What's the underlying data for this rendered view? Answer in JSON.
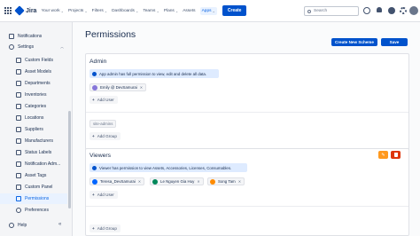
{
  "topnav": {
    "app_name": "Jira",
    "items": [
      {
        "label": "Your work",
        "has_chevron": true
      },
      {
        "label": "Projects",
        "has_chevron": true
      },
      {
        "label": "Filters",
        "has_chevron": true
      },
      {
        "label": "Dashboards",
        "has_chevron": true
      },
      {
        "label": "Teams",
        "has_chevron": true
      },
      {
        "label": "Plans",
        "has_chevron": true
      },
      {
        "label": "Assets",
        "has_chevron": false
      },
      {
        "label": "Apps",
        "has_chevron": true
      }
    ],
    "create_label": "Create",
    "search_placeholder": "Search",
    "chevron": "⌄"
  },
  "sidebar": {
    "notifications": "Notifications",
    "settings": "Settings",
    "items": [
      {
        "label": "Custom Fields",
        "icon": "custom-fields-icon"
      },
      {
        "label": "Asset Models",
        "icon": "asset-models-icon"
      },
      {
        "label": "Departments",
        "icon": "departments-icon"
      },
      {
        "label": "Inventories",
        "icon": "inventories-icon"
      },
      {
        "label": "Categories",
        "icon": "categories-icon"
      },
      {
        "label": "Locations",
        "icon": "locations-icon"
      },
      {
        "label": "Suppliers",
        "icon": "suppliers-icon"
      },
      {
        "label": "Manufacturers",
        "icon": "manufacturers-icon"
      },
      {
        "label": "Status Labels",
        "icon": "status-labels-icon"
      },
      {
        "label": "Notification Adm...",
        "icon": "notification-admin-icon"
      },
      {
        "label": "Asset Tags",
        "icon": "asset-tags-icon"
      },
      {
        "label": "Custom Panel",
        "icon": "custom-panel-icon"
      },
      {
        "label": "Permissions",
        "icon": "permissions-icon"
      },
      {
        "label": "Preferences",
        "icon": "preferences-icon"
      }
    ],
    "active_item": "Permissions",
    "help": "Help"
  },
  "main": {
    "title": "Permissions",
    "create_scheme_label": "Create New Scheme",
    "save_label": "Save",
    "admin": {
      "title": "Admin",
      "info": "App admin has full permission to view, edit and delete all data.",
      "users": [
        {
          "name": "Emily @ DevSamurai",
          "color": "#8777d9"
        }
      ],
      "add_user": "Add User",
      "groups": [
        "site-admins"
      ],
      "add_group": "Add Group"
    },
    "viewers": {
      "title": "Viewers",
      "info": "Viewer has permission to view Assets, Accessories, Licenses, Consumables.",
      "users": [
        {
          "name": "Teresa_DevSamurai",
          "color": "#0065ff"
        },
        {
          "name": "Le Nguyen Gia Huy",
          "color": "#00875a"
        },
        {
          "name": "Song Tam",
          "color": "#ff8b00"
        }
      ],
      "add_user": "Add User",
      "add_group": "Add Group"
    }
  }
}
